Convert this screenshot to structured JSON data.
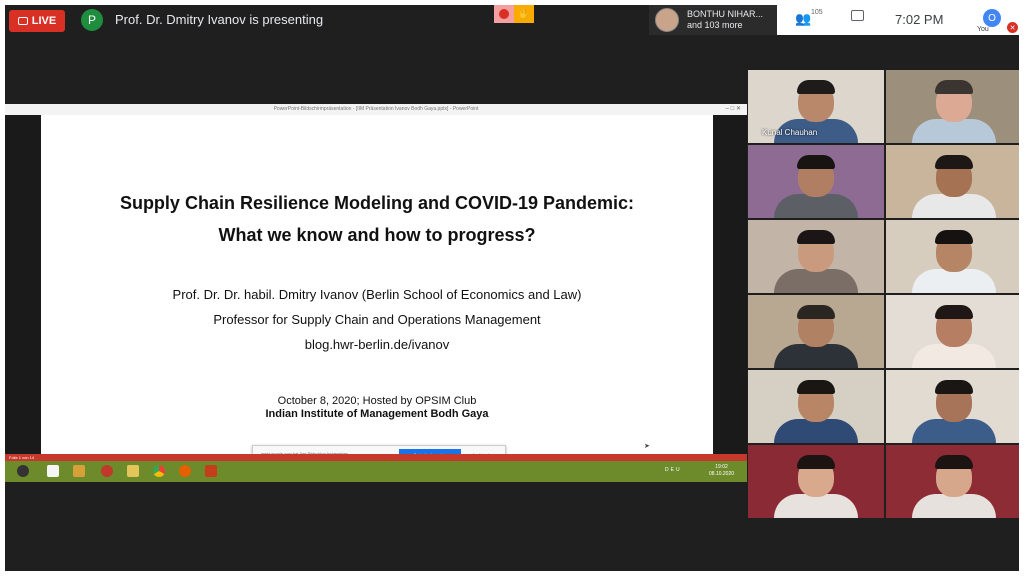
{
  "meeting": {
    "live_label": "LIVE",
    "presenter_initial": "P",
    "presenting_text": "Prof. Dr. Dmitry Ivanov is presenting",
    "participants_name": "BONTHU NIHAR...",
    "participants_more": "and 103 more",
    "people_count": "105",
    "time": "7:02 PM",
    "self_initial": "O",
    "self_label": "You"
  },
  "powerpoint": {
    "window_title": "PowerPoint-Bildschirmpräsentation - [IIM Präsentation Ivanov Bodh Gaya.pptx] - PowerPoint",
    "status_text": "Folie 1 von 14"
  },
  "slide": {
    "title_line1": "Supply Chain Resilience Modeling and COVID-19 Pandemic:",
    "title_line2": "What we know and how to progress?",
    "author": "Prof. Dr. Dr. habil. Dmitry Ivanov (Berlin School of Economics and Law)",
    "position": "Professor for Supply Chain and Operations Management",
    "blog": "blog.hwr-berlin.de/ivanov",
    "date_line": "October 8, 2020; Hosted by OPSIM Club",
    "institute": "Indian Institute of Management Bodh Gaya"
  },
  "notification": {
    "text": "meet.google.com hat Ihre Bildschirm freigegeben",
    "primary_button": "Freigabe beenden",
    "secondary_button": "Ausblenden"
  },
  "taskbar": {
    "clock_time": "19:02",
    "clock_date": "08.10.2020",
    "language": "DEU"
  },
  "tiles": [
    {
      "name": "Kunal Chauhan",
      "bg": "#dcd6cc",
      "skin": "#b9876a",
      "shirt": "#3d5c88",
      "hair": "#1e1b1a"
    },
    {
      "name": "",
      "bg": "#9c8f7c",
      "skin": "#dba994",
      "shirt": "#b7c9d9",
      "hair": "#3a3530"
    },
    {
      "name": "",
      "bg": "#8e6b93",
      "skin": "#b07f63",
      "shirt": "#5c6066",
      "hair": "#181412"
    },
    {
      "name": "",
      "bg": "#c9b49c",
      "skin": "#a57354",
      "shirt": "#e8e8e8",
      "hair": "#1d1816"
    },
    {
      "name": "",
      "bg": "#c2b5a8",
      "skin": "#c99a7e",
      "shirt": "#7a6e66",
      "hair": "#1b1515"
    },
    {
      "name": "",
      "bg": "#d7cdbf",
      "skin": "#b68566",
      "shirt": "#eceff2",
      "hair": "#161212"
    },
    {
      "name": "",
      "bg": "#b9a891",
      "skin": "#b08263",
      "shirt": "#2d3138",
      "hair": "#2a2622"
    },
    {
      "name": "",
      "bg": "#e3ddd5",
      "skin": "#b67e62",
      "shirt": "#f1e9e2",
      "hair": "#1f1715"
    },
    {
      "name": "",
      "bg": "#d6cfc4",
      "skin": "#b98567",
      "shirt": "#2e4a75",
      "hair": "#1a1614"
    },
    {
      "name": "",
      "bg": "#e2dbd2",
      "skin": "#a7745a",
      "shirt": "#3c5d8a",
      "hair": "#1a1614"
    },
    {
      "name": "",
      "bg": "#8a2a34",
      "skin": "#d9a98e",
      "shirt": "#e7e2dd",
      "hair": "#1c1412"
    },
    {
      "name": "",
      "bg": "#8e2c36",
      "skin": "#d7a78c",
      "shirt": "#e6e1dc",
      "hair": "#1c1412"
    }
  ],
  "colors": {
    "live_red": "#d93025",
    "accent_blue": "#1a73e8",
    "taskbar_green": "#6e8b2c"
  }
}
